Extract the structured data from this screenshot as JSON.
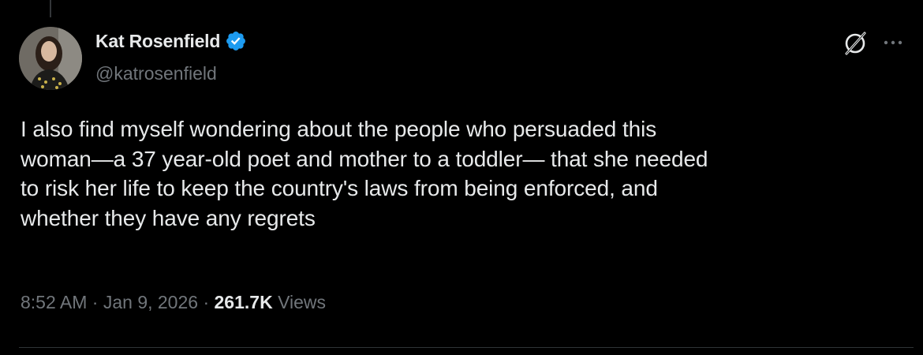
{
  "author": {
    "display_name": "Kat Rosenfield",
    "handle": "@katrosenfield",
    "verified": true
  },
  "tweet": {
    "text": "I also find myself wondering about the people who persuaded this\nwoman—a 37 year-old poet and mother to a toddler— that she needed\nto risk her life to keep the country's laws from being enforced, and\nwhether they have any regrets"
  },
  "meta": {
    "time": "8:52 AM",
    "separator": " · ",
    "date": "Jan 9, 2026",
    "views_count": "261.7K",
    "views_label": " Views"
  },
  "colors": {
    "background": "#000000",
    "primary_text": "#e7e9ea",
    "secondary_text": "#71767b",
    "verified_badge": "#1d9bf0"
  },
  "icons": {
    "verified": "verified-badge-icon",
    "grok": "grok-icon",
    "more": "more-options-icon"
  }
}
